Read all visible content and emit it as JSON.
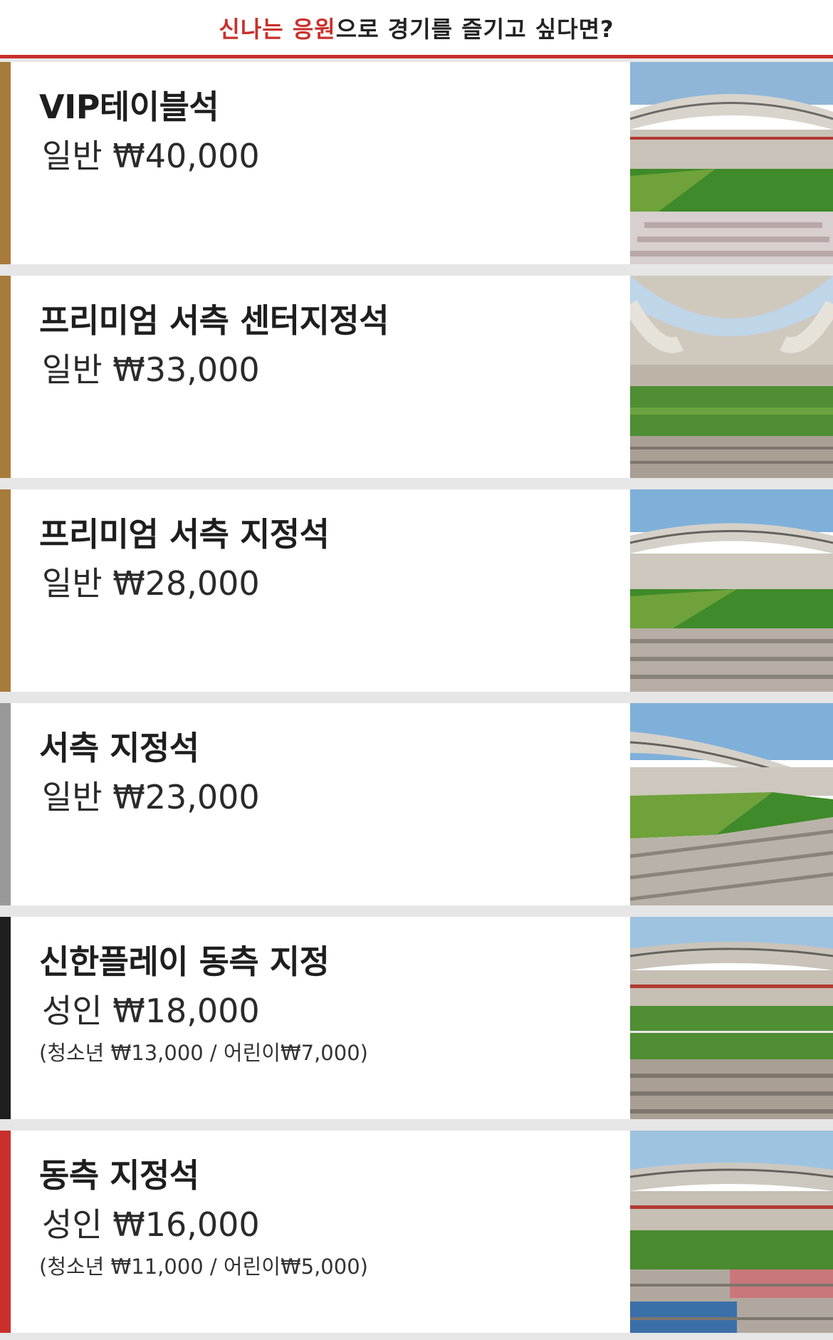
{
  "header": {
    "title_accent": "신나는 응원",
    "title_rest": "으로 경기를 즐기고 싶다면?"
  },
  "colors": {
    "accent": "#c9302c",
    "gold": "#a77b3b",
    "gray": "#999999",
    "black": "#1e1e1e",
    "red": "#c9302c"
  },
  "seats": [
    {
      "name": "VIP테이블석",
      "price": "일반 ₩40,000",
      "sub": "",
      "bar_color": "#a77b3b",
      "image": "stadium-photo"
    },
    {
      "name": "프리미엄 서측 센터지정석",
      "price": "일반 ₩33,000",
      "sub": "",
      "bar_color": "#a77b3b",
      "image": "stadium-photo"
    },
    {
      "name": "프리미엄 서측 지정석",
      "price": "일반 ₩28,000",
      "sub": "",
      "bar_color": "#a77b3b",
      "image": "stadium-photo"
    },
    {
      "name": "서측 지정석",
      "price": "일반 ₩23,000",
      "sub": "",
      "bar_color": "#999999",
      "image": "stadium-photo"
    },
    {
      "name": "신한플레이 동측 지정",
      "price": "성인 ₩18,000",
      "sub": "(청소년 ₩13,000 / 어린이₩7,000)",
      "bar_color": "#1e1e1e",
      "image": "stadium-photo"
    },
    {
      "name": "동측 지정석",
      "price": "성인 ₩16,000",
      "sub": "(청소년 ₩11,000 / 어린이₩5,000)",
      "bar_color": "#c9302c",
      "image": "stadium-photo"
    }
  ]
}
